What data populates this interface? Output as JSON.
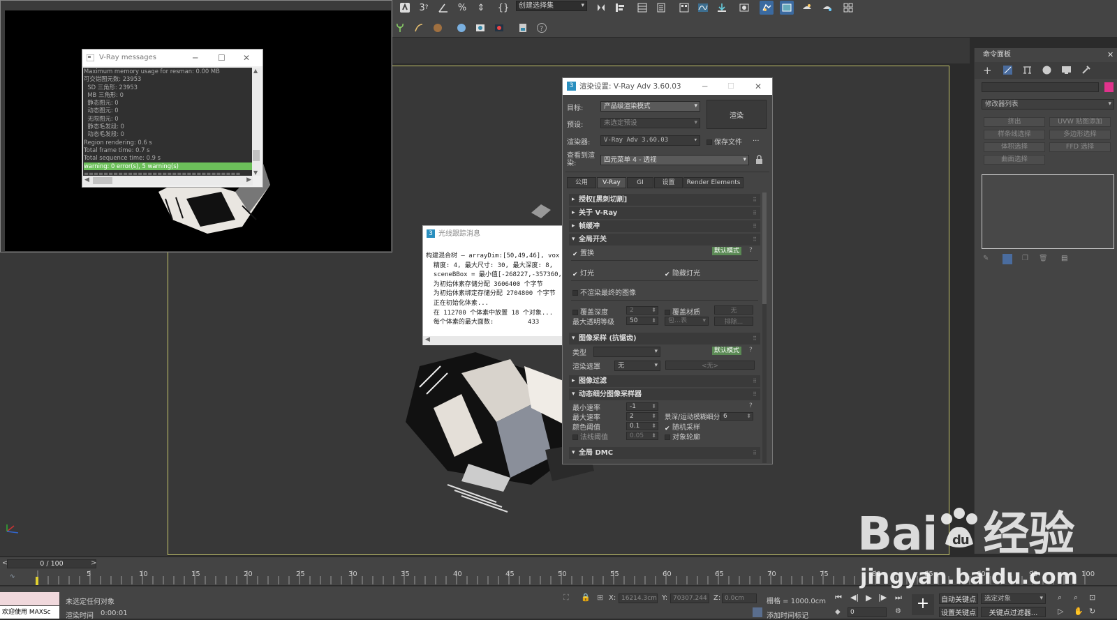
{
  "toolbar": {
    "selection_set": "创建选择集",
    "icons": [
      "select-icon",
      "snap-3-icon",
      "angle-snap-icon",
      "percent-snap-icon",
      "spinner-snap-icon",
      "named-selection-icon",
      "mirror-icon",
      "align-icon",
      "layer-explorer-icon",
      "scene-explorer-icon",
      "toggle-ribbon-icon",
      "curve-editor-icon",
      "schematic-icon",
      "material-editor-icon",
      "render-setup-icon",
      "rendered-frame-icon",
      "render-icon",
      "render-iterative-icon",
      "render-cloud-icon",
      "grid-icon"
    ]
  },
  "vray_messages": {
    "title": "V-Ray messages",
    "lines": [
      "Maximum memory usage for resman: 0.00 MB",
      "可交错图元数: 23953",
      "  SD 三角形: 23953",
      "  MB 三角形: 0",
      "  静态图元: 0",
      "  动态图元: 0",
      "  无限图元: 0",
      "  静态毛发段: 0",
      "  动态毛发段: 0",
      "Region rendering: 0.6 s",
      "Total frame time: 0.7 s",
      "Total sequence time: 0.9 s",
      "warning: 0 error(s), 5 warning(s)",
      "================================"
    ]
  },
  "trace": {
    "title": "光线跟踪消息",
    "lines": [
      "构建混合树 — arrayDim:[50,49,46], vox",
      "  精度: 4, 最大尺寸: 30, 最大深度: 8,",
      "  sceneBBox = 最小值[-268227,-357360,-",
      "  为初始体素存储分配 3606400 个字节",
      "  为初始体素绑定存储分配 2704800 个字节",
      "  正在初始化体素...",
      "  在 112700 个体素中放置 18 个对象...",
      "  每个体素的最大面数:         433"
    ]
  },
  "render_setup": {
    "title": "渲染设置: V-Ray Adv 3.60.03",
    "target_label": "目标:",
    "target_value": "产品级渲染模式",
    "preset_label": "预设:",
    "preset_value": "未选定预设",
    "renderer_label": "渲染器:",
    "renderer_value": "V-Ray Adv 3.60.03",
    "save_file_label": "保存文件",
    "more": "...",
    "view_label": "查看到渲染:",
    "view_value": "四元菜单 4 - 透视",
    "render_button": "渲染",
    "tabs": [
      "公用",
      "V-Ray",
      "GI",
      "设置",
      "Render Elements"
    ],
    "rollouts": {
      "license": "授权[黑刺切刷]",
      "about": "关于 V-Ray",
      "framebuffer": "帧缓冲",
      "global": "全局开关",
      "image_sampler": "图像采样 (抗锯齿)",
      "image_filter": "图像过滤",
      "adaptive": "动态细分图像采样器",
      "global_dmc": "全局 DMC"
    },
    "global": {
      "displacement": "置换",
      "default_mode": "默认模式",
      "help": "?",
      "lights": "灯光",
      "hidden_lights": "隐藏灯光",
      "dont_render_final": "不渲染最终的图像",
      "override_depth": "覆盖深度",
      "override_depth_value": "2",
      "override_mtl": "覆盖材质",
      "none": "无",
      "max_trans": "最大透明等级",
      "max_trans_value": "50",
      "include": "包…表",
      "exclude": "排除..."
    },
    "sampler": {
      "type_label": "类型",
      "type_value": "",
      "default_mode": "默认模式",
      "mask_label": "渲染遮罩",
      "mask_value": "无",
      "mask_none": "<无>"
    },
    "adaptive": {
      "min_rate": "最小速率",
      "min_rate_value": "-1",
      "max_rate": "最大速率",
      "max_rate_value": "2",
      "dof_label": "景深/运动模糊细分",
      "dof_value": "6",
      "color_thresh": "颜色阈值",
      "color_thresh_value": "0.1",
      "random": "随机采样",
      "normal_thresh": "法线阈值",
      "normal_thresh_value": "0.05",
      "outline": "对象轮廓"
    }
  },
  "command_panel": {
    "title": "命令面板",
    "modifier_list": "修改器列表",
    "buttons": [
      "挤出",
      "UVW 贴图添加",
      "样条线选择",
      "多边形选择",
      "体积选择",
      "FFD 选择",
      "曲面选择"
    ],
    "swatch": "#e0338c"
  },
  "timeline": {
    "frame": "0 / 100",
    "ticks": [
      "0",
      "5",
      "10",
      "15",
      "20",
      "25",
      "30",
      "35",
      "40",
      "45",
      "50",
      "55",
      "60",
      "65",
      "70",
      "75",
      "80",
      "85",
      "90",
      "95",
      "100"
    ]
  },
  "status": {
    "welcome": "欢迎使用 MAXSc",
    "selection": "未选定任何对象",
    "render_time_label": "渲染时间",
    "render_time": "0:00:01",
    "x_label": "X:",
    "x_value": "16214.3cm",
    "y_label": "Y:",
    "y_value": "70307.244",
    "z_label": "Z:",
    "z_value": "0.0cm",
    "grid": "栅格 = 1000.0cm",
    "add_time_tag": "添加时间标记",
    "auto_key": "自动关键点",
    "set_key": "设置关键点",
    "selected": "选定对象",
    "key_filter": "关键点过滤器...",
    "frame_field": "0"
  },
  "watermark": {
    "brand": "Bai",
    "brand_cn": "经验",
    "url": "jingyan.baidu.com"
  }
}
